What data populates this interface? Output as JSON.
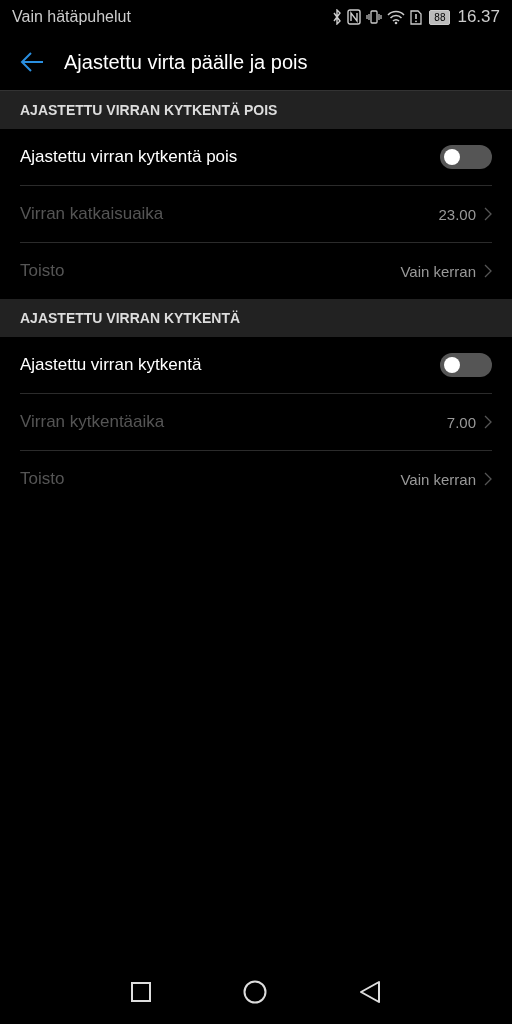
{
  "status_bar": {
    "carrier": "Vain hätäpuhelut",
    "battery": "88",
    "time": "16.37"
  },
  "app_bar": {
    "title": "Ajastettu virta päälle ja pois"
  },
  "sections": [
    {
      "header": "AJASTETTU VIRRAN KYTKENTÄ POIS",
      "rows": [
        {
          "kind": "toggle",
          "label": "Ajastettu virran kytkentä pois",
          "on": false,
          "disabled": false
        },
        {
          "kind": "value",
          "label": "Virran katkaisuaika",
          "value": "23.00",
          "disabled": true
        },
        {
          "kind": "value",
          "label": "Toisto",
          "value": "Vain kerran",
          "disabled": true
        }
      ]
    },
    {
      "header": "AJASTETTU VIRRAN KYTKENTÄ",
      "rows": [
        {
          "kind": "toggle",
          "label": "Ajastettu virran kytkentä",
          "on": false,
          "disabled": false
        },
        {
          "kind": "value",
          "label": "Virran kytkentäaika",
          "value": "7.00",
          "disabled": true
        },
        {
          "kind": "value",
          "label": "Toisto",
          "value": "Vain kerran",
          "disabled": true
        }
      ]
    }
  ]
}
